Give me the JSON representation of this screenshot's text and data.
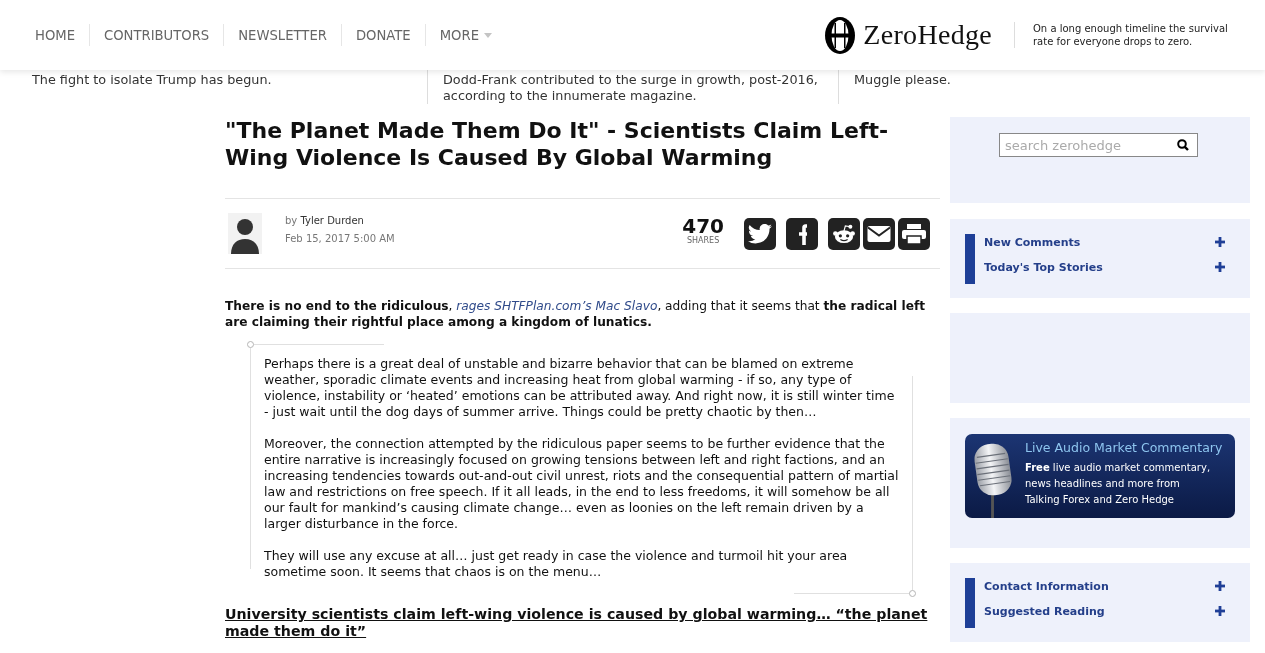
{
  "nav": [
    {
      "label": "HOME",
      "kind": "link"
    },
    {
      "label": "CONTRIBUTORS",
      "kind": "link"
    },
    {
      "label": "NEWSLETTER",
      "kind": "link"
    },
    {
      "label": "DONATE",
      "kind": "link"
    },
    {
      "label": "MORE",
      "kind": "dropdown"
    }
  ],
  "logo": {
    "text": "ZeroHedge",
    "tagline": "On a long enough timeline the survival rate for everyone drops to zero."
  },
  "teasers": [
    {
      "lines": [
        "The fight to isolate Trump has begun."
      ]
    },
    {
      "lines": [
        "Dodd-Frank contributed to the surge in growth, post-2016,",
        "according to the innumerate magazine."
      ]
    },
    {
      "lines": [
        "Muggle please."
      ]
    }
  ],
  "article": {
    "title": "\"The Planet Made Them Do It\" - Scientists Claim Left-Wing Violence Is Caused By Global Warming",
    "byline_prefix": "by",
    "author": "Tyler Durden",
    "date": "Feb 15, 2017 5:00 AM",
    "share_count": "470",
    "share_label": "SHARES",
    "share_buttons": [
      {
        "kind": "twitter"
      },
      {
        "kind": "facebook"
      },
      {
        "kind": "reddit"
      },
      {
        "kind": "email"
      },
      {
        "kind": "print"
      }
    ],
    "intro": {
      "before": "**There is no end to the ridiculous**, ",
      "link": "rages SHTFPlan.com’s Mac Slavo",
      "after": ", adding that it seems that **the radical left are claiming their rightful place among a kingdom of lunatics.**"
    },
    "quote": [
      "Perhaps there is a great deal of unstable and bizarre behavior that can be blamed on extreme weather, sporadic climate events and increasing heat from global warming - if so, any type of violence, instability or ‘heated’ emotions can be attributed away. And right now, it is still winter time - just wait until the dog days of summer arrive. Things could be pretty chaotic by then…",
      "Moreover, the connection attempted by the ridiculous paper seems to be further evidence that the entire narrative is increasingly focused on growing tensions between left and right factions, and an increasing tendencies towards out-and-out civil unrest, riots and the consequential pattern of martial law and restrictions on free speech. If it all leads, in the end to less freedoms, it will somehow be all our fault for mankind’s causing climate change… even as loonies on the left remain driven by a larger disturbance in the force.",
      "They will use any excuse at all… just get ready in case the violence and turmoil hit your area sometime soon. It seems that chaos is on the menu…"
    ],
    "link_heading": "University scientists claim left-wing violence is caused by global warming… “the planet made them do it”"
  },
  "sidebar": {
    "panels": [
      {
        "kind": "search",
        "placeholder": "search zerohedge"
      },
      {
        "kind": "menu",
        "items": [
          {
            "label": "New Comments",
            "expanded": false
          },
          {
            "label": "Today's Top Stories",
            "expanded": false
          }
        ]
      },
      {
        "kind": "blank"
      },
      {
        "kind": "ad",
        "title": "Live Audio Market Commentary",
        "lines": [
          "**Free** live audio market commentary,",
          "news headlines and more from",
          "Talking Forex and Zero Hedge"
        ]
      },
      {
        "kind": "menu",
        "items": [
          {
            "label": "Contact Information",
            "expanded": false
          },
          {
            "label": "Suggested Reading",
            "expanded": false
          }
        ]
      }
    ]
  }
}
